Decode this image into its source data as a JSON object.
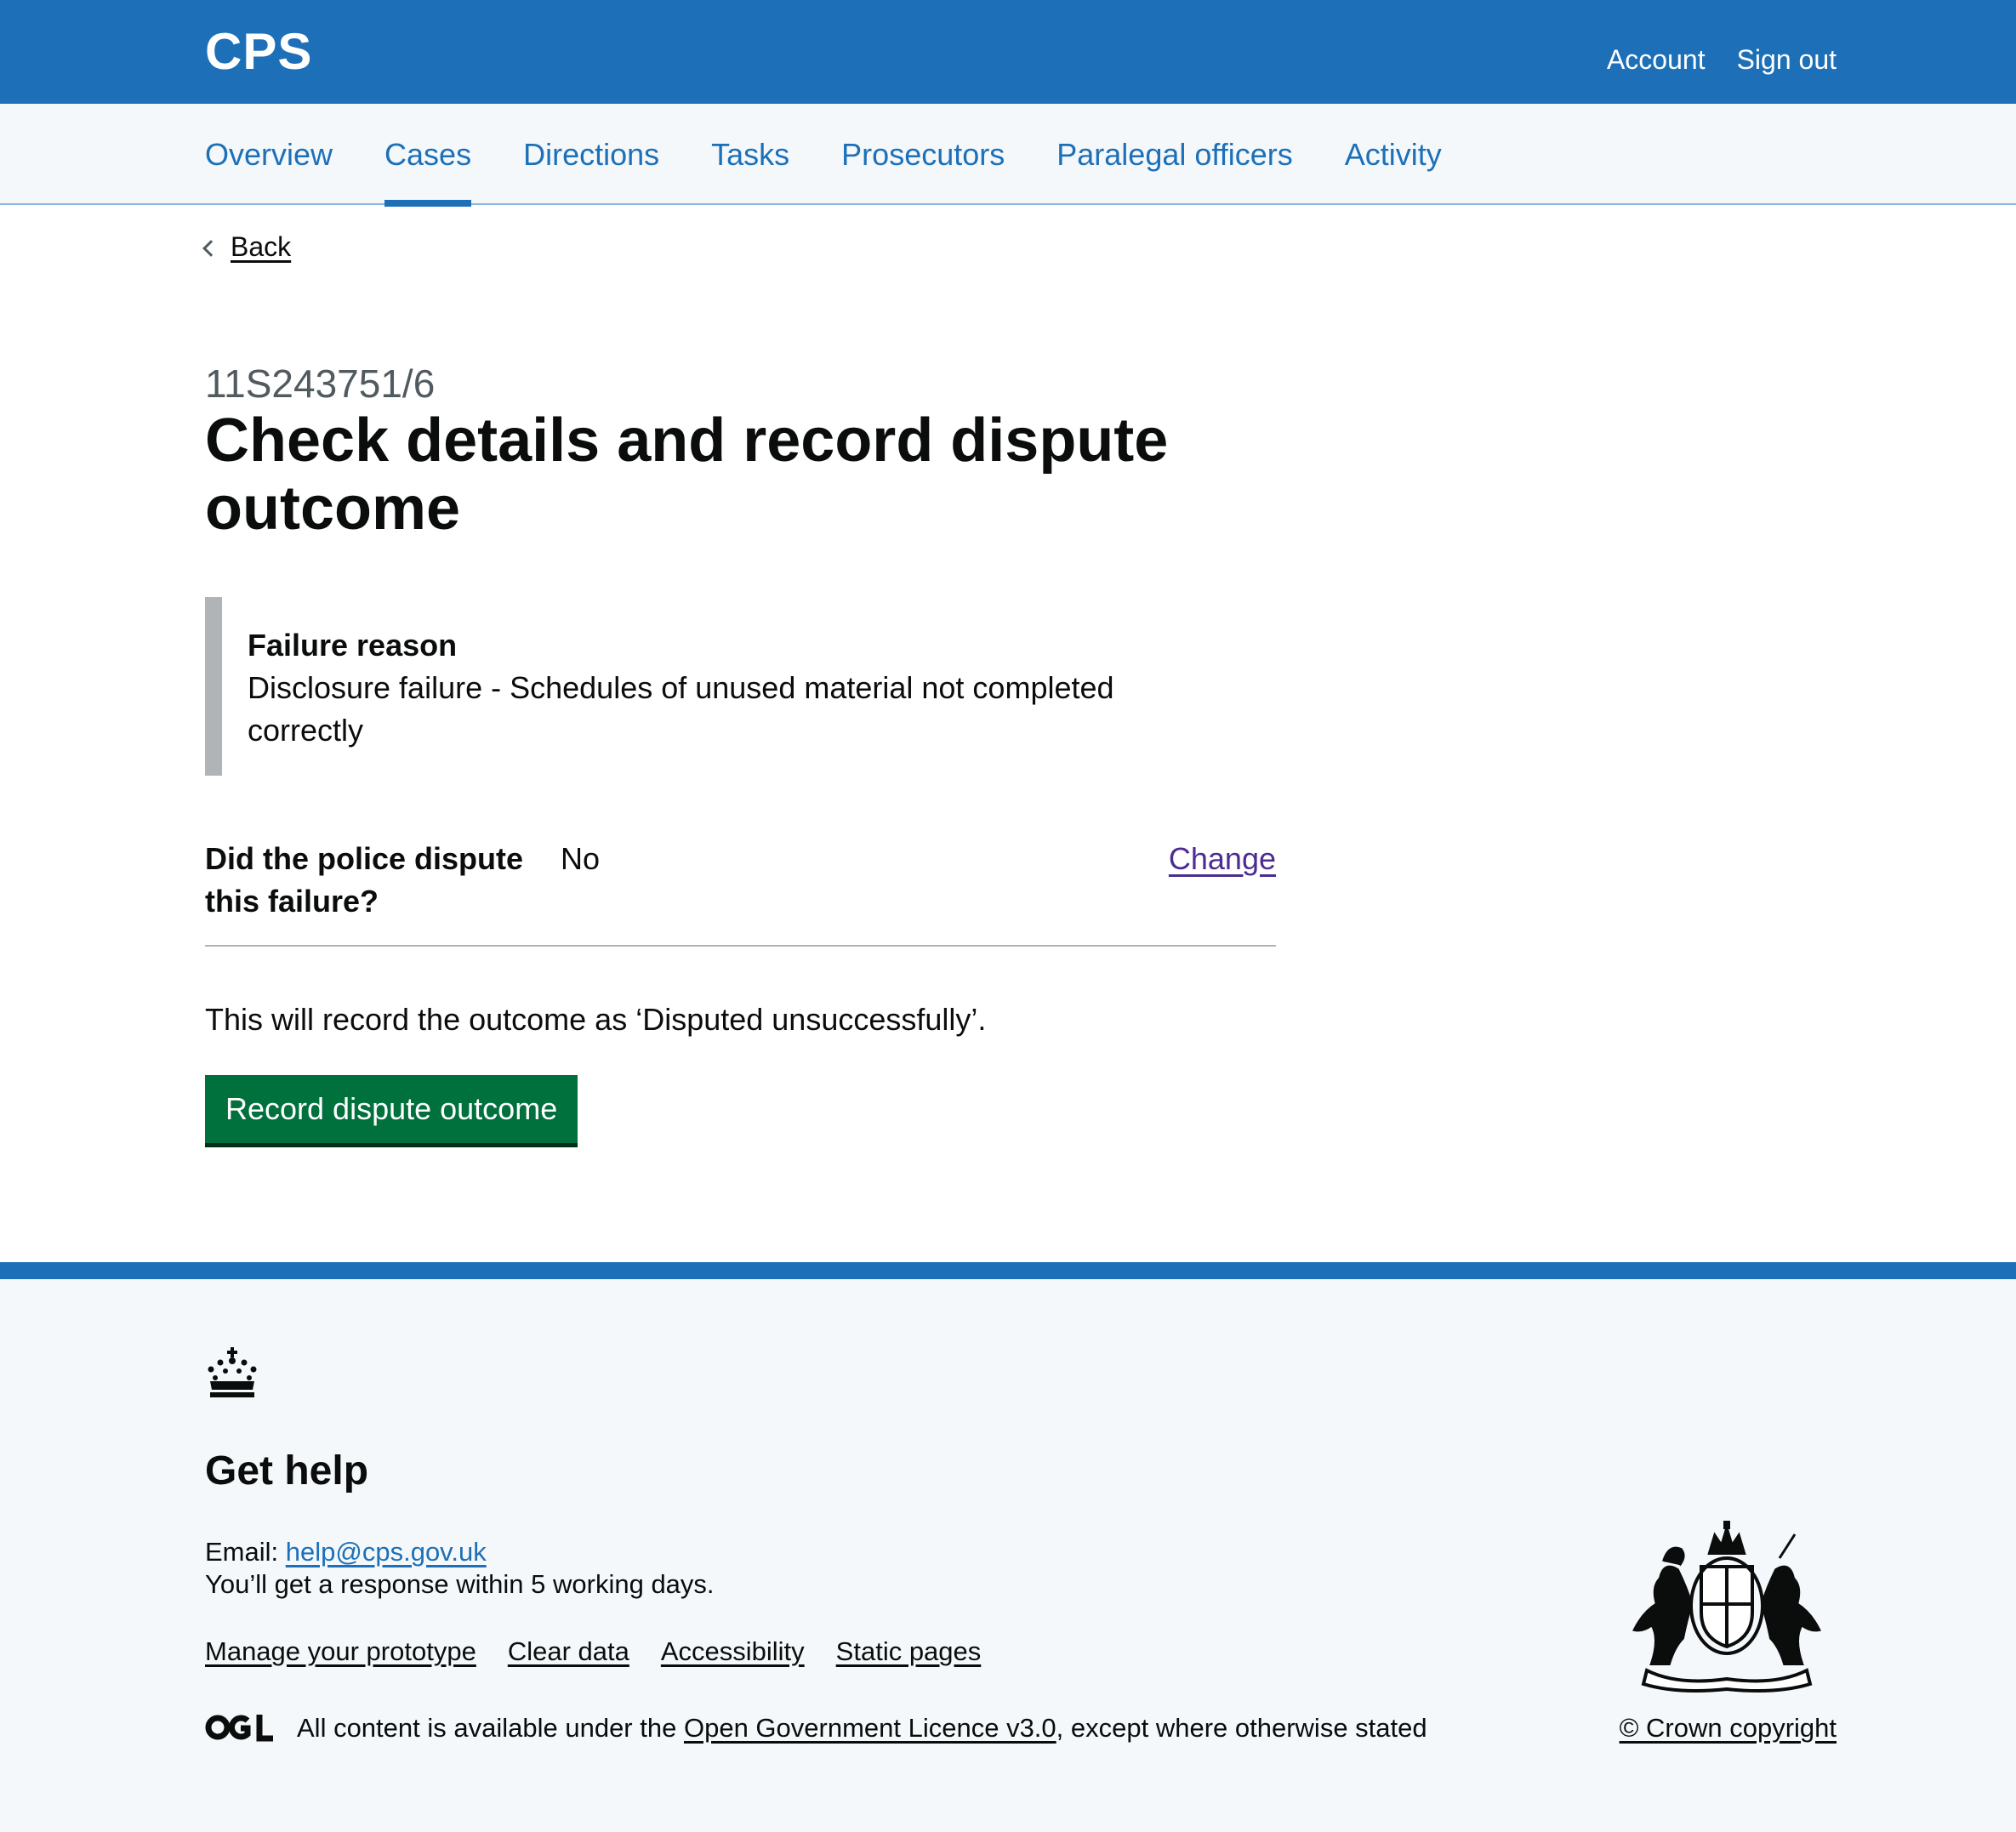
{
  "header": {
    "logo": "CPS",
    "links": [
      "Account",
      "Sign out"
    ]
  },
  "nav": {
    "items": [
      "Overview",
      "Cases",
      "Directions",
      "Tasks",
      "Prosecutors",
      "Paralegal officers",
      "Activity"
    ],
    "active": "Cases"
  },
  "main": {
    "back_label": "Back",
    "caption": "11S243751/6",
    "title": "Check details and record dispute outcome",
    "inset": {
      "title": "Failure reason",
      "text": "Disclosure failure - Schedules of unused material not completed correctly"
    },
    "summary": {
      "key": "Did the police dispute this failure?",
      "value": "No",
      "action": "Change"
    },
    "outcome_text": "This will record the outcome as ‘Disputed unsuccessfully’.",
    "button_label": "Record dispute outcome"
  },
  "footer": {
    "heading": "Get help",
    "email_label": "Email:",
    "email": "help@cps.gov.uk",
    "response_text": "You’ll get a response within 5 working days.",
    "links": [
      "Manage your prototype",
      "Clear data",
      "Accessibility",
      "Static pages"
    ],
    "licence_prefix": "All content is available under the",
    "licence_link": "Open Government Licence v3.0",
    "licence_suffix": ", except where otherwise stated",
    "copyright": "© Crown copyright"
  },
  "icons": {
    "back": "chevron-left-icon",
    "crown": "crown-icon",
    "ogl": "ogl-logo-icon",
    "coat_of_arms": "royal-coat-of-arms-icon"
  },
  "colors": {
    "brand_blue": "#1d70b8",
    "button_green": "#00703c",
    "visited_link": "#4c2c92",
    "inset_border": "#b1b4b6",
    "footer_bg": "#f4f8fb"
  }
}
